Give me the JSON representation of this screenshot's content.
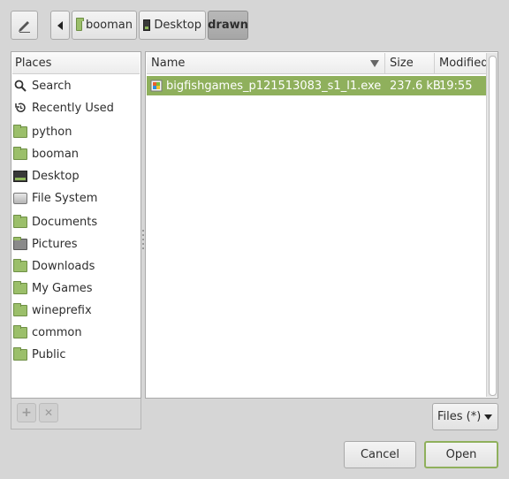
{
  "toolbar": {
    "edit_icon": "pencil-icon",
    "back_icon": "left-arrow-icon",
    "breadcrumbs": [
      {
        "label": "booman",
        "icon": "home-folder-icon"
      },
      {
        "label": "Desktop",
        "icon": "desktop-icon"
      },
      {
        "label": "drawn",
        "active": true
      }
    ]
  },
  "places": {
    "header": "Places",
    "items": [
      {
        "label": "Search",
        "icon": "search-icon"
      },
      {
        "label": "Recently Used",
        "icon": "recent-icon"
      },
      {
        "label": "python",
        "icon": "folder-icon"
      },
      {
        "label": "booman",
        "icon": "home-folder-icon"
      },
      {
        "label": "Desktop",
        "icon": "desktop-icon"
      },
      {
        "label": "File System",
        "icon": "drive-icon"
      },
      {
        "label": "Documents",
        "icon": "documents-folder-icon"
      },
      {
        "label": "Pictures",
        "icon": "pictures-folder-icon"
      },
      {
        "label": "Downloads",
        "icon": "downloads-folder-icon"
      },
      {
        "label": "My Games",
        "icon": "folder-icon"
      },
      {
        "label": "wineprefix",
        "icon": "folder-icon"
      },
      {
        "label": "common",
        "icon": "folder-icon"
      },
      {
        "label": "Public",
        "icon": "public-folder-icon"
      }
    ],
    "add_icon": "plus-icon",
    "remove_icon": "x-icon"
  },
  "files": {
    "columns": {
      "name": "Name",
      "size": "Size",
      "modified": "Modified"
    },
    "sort_icon": "sort-descending-icon",
    "rows": [
      {
        "name": "bigfishgames_p121513083_s1_l1.exe",
        "size": "237.6 kB",
        "modified": "19:55",
        "selected": true
      }
    ]
  },
  "filter": {
    "selected": "Files (*)"
  },
  "actions": {
    "cancel": "Cancel",
    "open": "Open"
  },
  "colors": {
    "selection": "#8fb05c",
    "folder": "#9bbf6a",
    "background": "#d6d6d6"
  }
}
